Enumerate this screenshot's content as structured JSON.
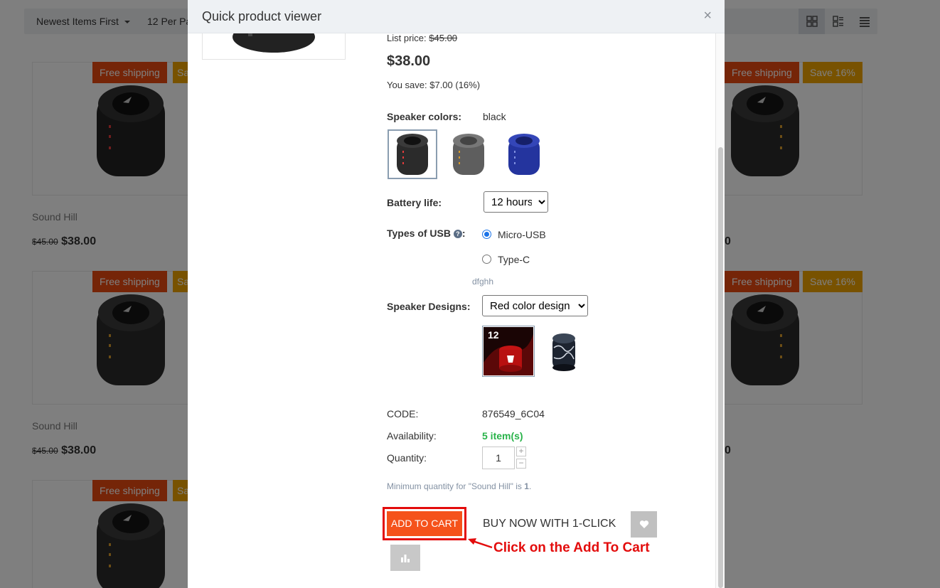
{
  "background": {
    "sort": {
      "selected": "Newest Items First"
    },
    "per_page": {
      "label": "12 Per Pa"
    },
    "products": [
      {
        "name": "Sound Hill",
        "old_price": "$45.00",
        "price": "$38.00",
        "badges": [
          "Free shipping",
          "Sa"
        ]
      },
      {
        "name": "Sound Hill",
        "old_price": "$45.00",
        "price": "$38.00",
        "badges": [
          "Free shipping",
          "Sa"
        ]
      },
      {
        "badges": [
          "Free shipping",
          "Sa"
        ]
      },
      {
        "price_fragment": "0",
        "badges": [
          "Free shipping",
          "Save 16%"
        ]
      },
      {
        "price_fragment": "0",
        "badges": [
          "Free shipping",
          "Save 16%"
        ]
      }
    ]
  },
  "modal": {
    "title": "Quick product viewer",
    "close": "×",
    "list_price_label": "List price:",
    "list_price_value": "$45.00",
    "price": "$38.00",
    "you_save": "You save: $7.00 (16%)",
    "colors": {
      "label": "Speaker colors:",
      "selected": "black",
      "swatches": [
        {
          "name": "black",
          "color": "#2b2b2b",
          "accent": "#e23b3b"
        },
        {
          "name": "gray",
          "color": "#5e5e5e",
          "accent": "#d89b2a"
        },
        {
          "name": "blue",
          "color": "#24349e",
          "accent": "#7f8fe0"
        }
      ]
    },
    "battery": {
      "label": "Battery life:",
      "selected": "12 hours"
    },
    "usb": {
      "label": "Types of USB",
      "options": [
        {
          "label": "Micro-USB",
          "checked": true
        },
        {
          "label": "Type-C",
          "checked": false
        }
      ],
      "note": "dfghh"
    },
    "designs": {
      "label": "Speaker Designs:",
      "selected": "Red color design",
      "img1_text": "12"
    },
    "code": {
      "label": "CODE:",
      "value": "876549_6C04"
    },
    "availability": {
      "label": "Availability:",
      "value": "5 item(s)"
    },
    "quantity": {
      "label": "Quantity:",
      "value": "1",
      "plus": "+",
      "minus": "−"
    },
    "min_qty": {
      "text": "Minimum quantity for \"Sound Hill\" is ",
      "value": "1",
      "suffix": "."
    },
    "add_to_cart": "ADD TO CART",
    "buy_now": "BUY NOW WITH 1-CLICK",
    "annotation": "Click on the Add To Cart"
  },
  "colors": {
    "accent_orange": "#f5521b",
    "annotation_red": "#e30c0c",
    "in_stock_green": "#29b34a"
  }
}
